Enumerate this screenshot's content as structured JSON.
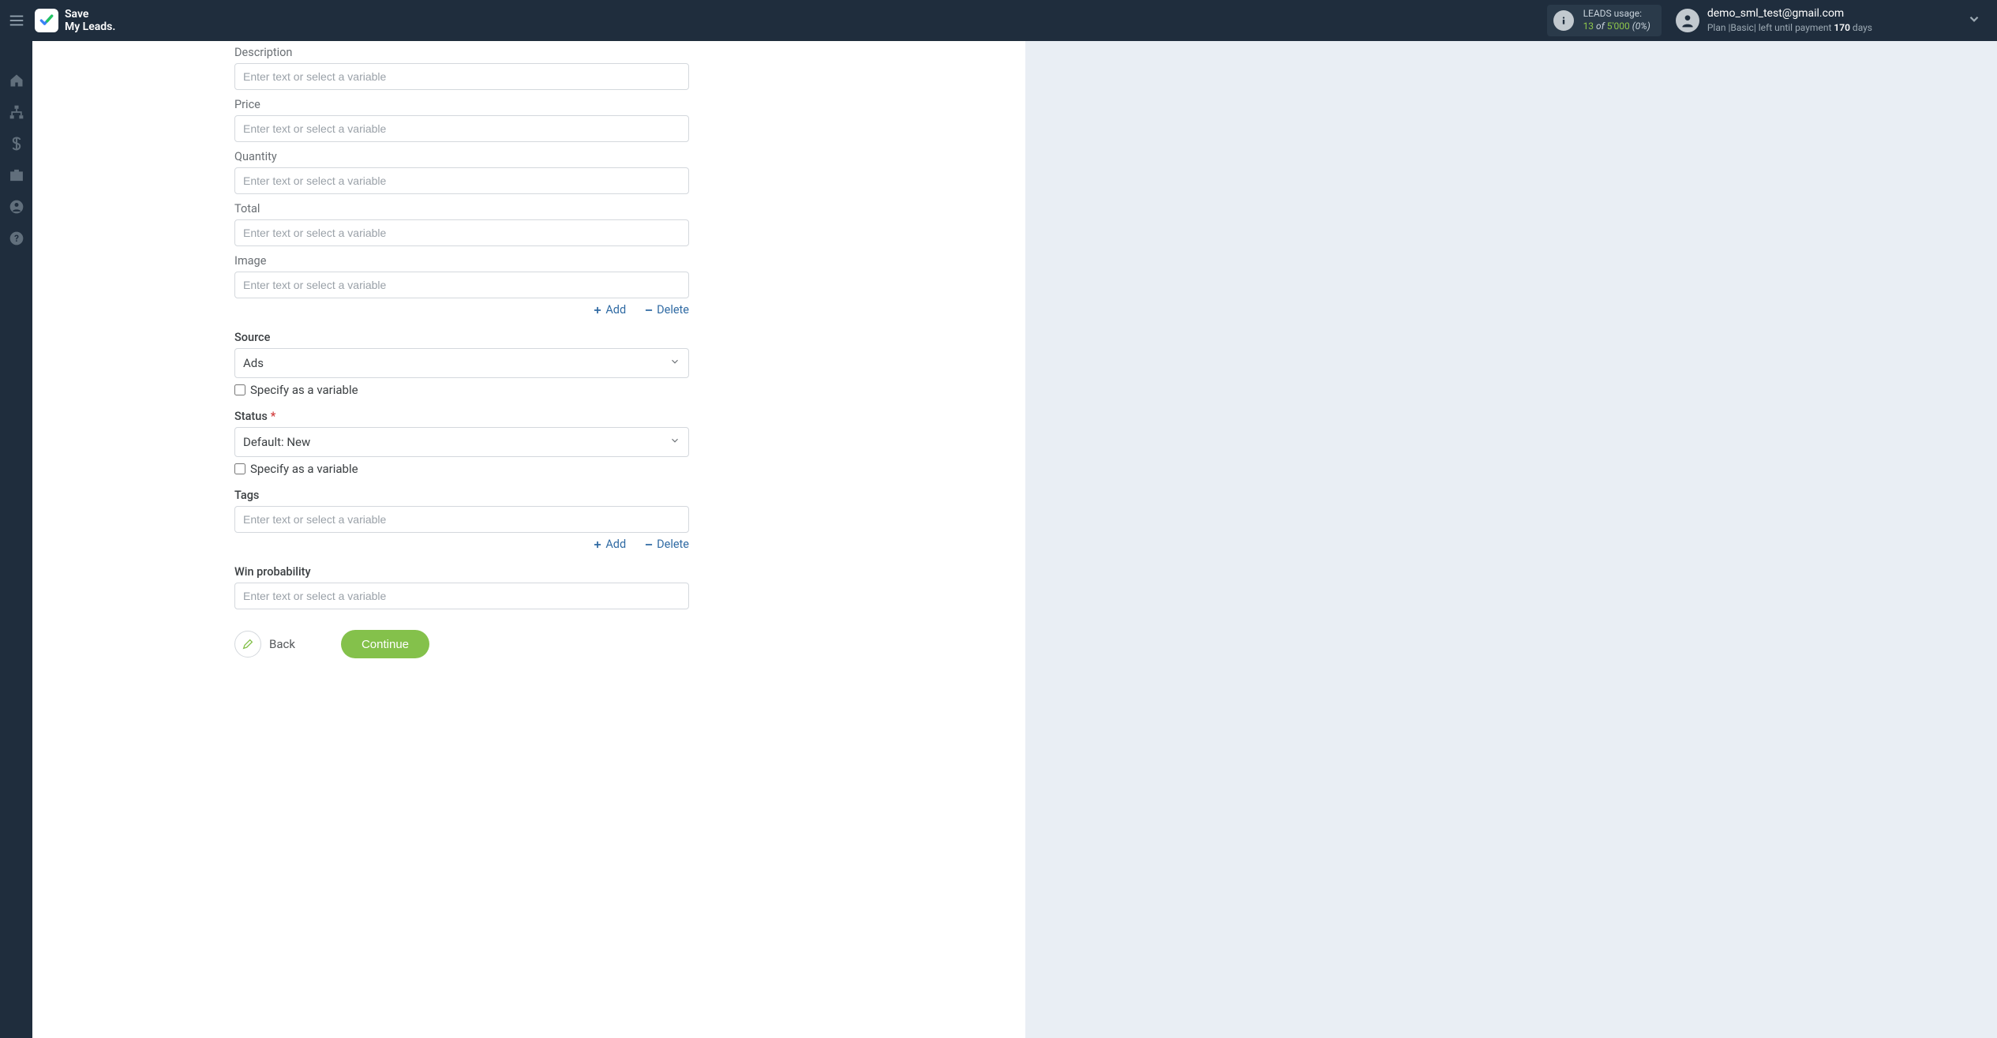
{
  "header": {
    "logo_line1": "Save",
    "logo_line2": "My Leads.",
    "usage_label": "LEADS usage:",
    "usage_count": "13",
    "usage_of": "of",
    "usage_total": "5'000",
    "usage_pct": "(0%)",
    "user_email": "demo_sml_test@gmail.com",
    "plan_prefix": "Plan |",
    "plan_name": "Basic",
    "plan_suffix": "| left until payment",
    "plan_days": "170",
    "plan_days_word": "days"
  },
  "form": {
    "placeholder": "Enter text or select a variable",
    "description_label": "Description",
    "price_label": "Price",
    "quantity_label": "Quantity",
    "total_label": "Total",
    "image_label": "Image",
    "add_label": "Add",
    "delete_label": "Delete",
    "source_label": "Source",
    "source_value": "Ads",
    "specify_variable_label": "Specify as a variable",
    "status_label": "Status",
    "status_value": "Default: New",
    "tags_label": "Tags",
    "winprob_label": "Win probability",
    "back_label": "Back",
    "continue_label": "Continue"
  }
}
